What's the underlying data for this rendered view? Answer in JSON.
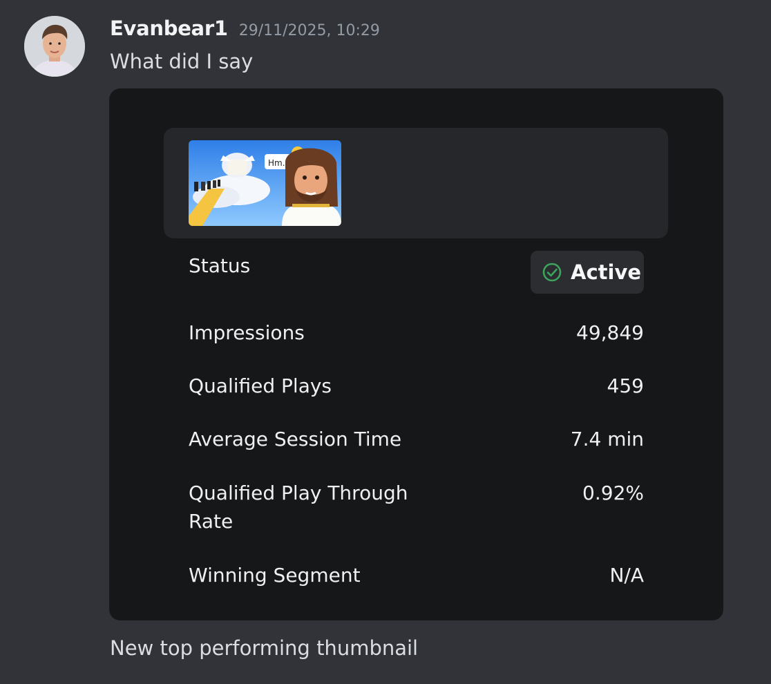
{
  "message": {
    "username": "Evanbear1",
    "timestamp": "29/11/2025, 10:29",
    "text": "What did I say",
    "followup_text": "New top performing thumbnail"
  },
  "thumbnail": {
    "speech_bubble": "Hm..."
  },
  "stats": {
    "status_label": "Status",
    "status_value": "Active",
    "rows": [
      {
        "label": "Impressions",
        "value": "49,849"
      },
      {
        "label": "Qualified Plays",
        "value": "459"
      },
      {
        "label": "Average Session Time",
        "value": "7.4 min"
      },
      {
        "label_line1": "Qualified Play Through",
        "label_line2": "Rate",
        "value": "0.92%"
      },
      {
        "label": "Winning Segment",
        "value": "N/A"
      }
    ]
  },
  "colors": {
    "background": "#313338",
    "card": "#161719",
    "panel": "#26272b",
    "accent_green": "#3ba55c"
  }
}
